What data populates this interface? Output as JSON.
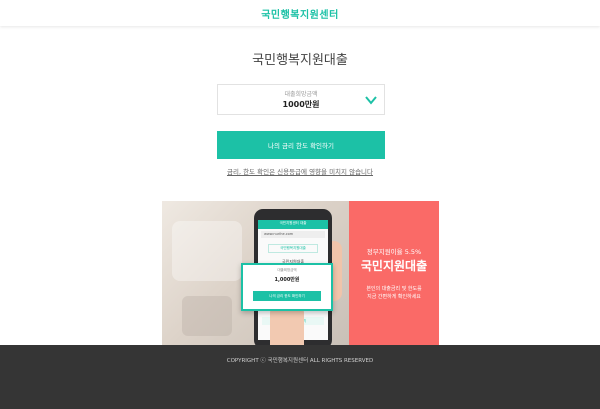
{
  "header": {
    "brand": "국민행복지원센터"
  },
  "main": {
    "title": "국민행복지원대출",
    "amount_field": {
      "label": "대출희망금액",
      "value": "1000만원"
    },
    "cta_label": "나의 금리 한도 확인하기",
    "notice": "금리, 한도 확인은 신용등급에 영향을 미치지 않습니다"
  },
  "promo": {
    "phone": {
      "header": "국민지원센터 대출",
      "url": "www.nurihe.com",
      "pill": "국민행복지원대출",
      "sub": "국민지원대출",
      "card_label": "대출희망금액",
      "card_value": "1,000만원",
      "card_button": "나의 금리 한도 확인하기",
      "bottom_button": "금리, 한도 확인하기"
    },
    "subtitle": "정부지원이율 5.5%",
    "title": "국민지원대출",
    "desc_line1": "본인의 대출금리 및 한도를",
    "desc_line2": "지금 간편하게 확인하세요"
  },
  "footer": {
    "copyright": "COPYRIGHT ⓒ 국민행복지원센터 ALL RIGHTS RESERVED"
  },
  "colors": {
    "accent": "#1cc1a6",
    "promo_red": "#fa6a67",
    "footer_bg": "#353535"
  },
  "icons": {
    "dropdown": "chevron-down-icon"
  }
}
